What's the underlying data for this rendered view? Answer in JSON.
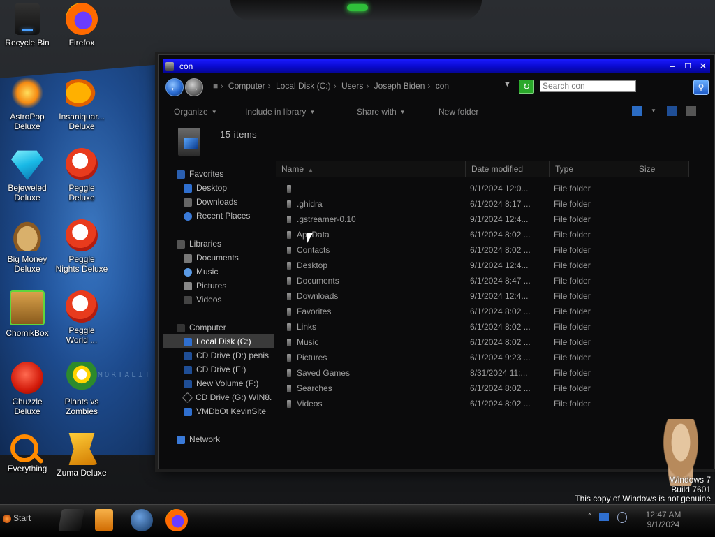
{
  "desktop": {
    "icons": [
      {
        "label": "Recycle Bin",
        "icon": "recycle-bin-icon"
      },
      {
        "label": "Firefox",
        "icon": "firefox-icon"
      },
      {
        "label": "AstroPop\nDeluxe",
        "icon": "astropop-icon"
      },
      {
        "label": "Insaniquar...\nDeluxe",
        "icon": "insaniquarium-icon"
      },
      {
        "label": "Bejeweled\nDeluxe",
        "icon": "bejeweled-icon"
      },
      {
        "label": "Peggle\nDeluxe",
        "icon": "peggle-icon"
      },
      {
        "label": "Big Money\nDeluxe",
        "icon": "big-money-icon"
      },
      {
        "label": "Peggle\nNights Deluxe",
        "icon": "peggle-nights-icon"
      },
      {
        "label": "ChomikBox",
        "icon": "chomikbox-icon"
      },
      {
        "label": "Peggle\nWorld ...",
        "icon": "peggle-world-icon"
      },
      {
        "label": "Chuzzle\nDeluxe",
        "icon": "chuzzle-icon"
      },
      {
        "label": "Plants vs\nZombies",
        "icon": "plants-vs-zombies-icon"
      },
      {
        "label": "Everything",
        "icon": "everything-search-icon"
      },
      {
        "label": "Zuma Deluxe",
        "icon": "zuma-icon"
      }
    ],
    "wallpaper_text": "MORTALIT",
    "watermark": {
      "line1": "Windows 7",
      "line2": "Build 7601",
      "line3": "This copy of Windows is not genuine"
    }
  },
  "window": {
    "title": "con",
    "controls": {
      "minimize": "–",
      "maximize": "☐",
      "close": "✕"
    },
    "breadcrumb": [
      "Computer",
      "Local Disk (C:)",
      "Users",
      "Joseph Biden",
      "con"
    ],
    "search_placeholder": "Search con",
    "commands": {
      "organize": "Organize",
      "include": "Include in library",
      "share": "Share with",
      "new_folder": "New folder"
    },
    "item_count": "15 items",
    "nav": {
      "favorites": "Favorites",
      "fav_items": [
        "Desktop",
        "Downloads",
        "Recent Places"
      ],
      "libraries": "Libraries",
      "lib_items": [
        "Documents",
        "Music",
        "Pictures",
        "Videos"
      ],
      "computer": "Computer",
      "comp_items": [
        "Local Disk (C:)",
        "CD Drive (D:) penis",
        "CD Drive (E:)",
        "New Volume (F:)",
        "CD Drive (G:) WIN8.",
        "VMDbOt KevinSite"
      ],
      "network": "Network"
    },
    "columns": {
      "name": "Name",
      "date": "Date modified",
      "type": "Type",
      "size": "Size"
    },
    "files": [
      {
        "name": "",
        "date": "9/1/2024 12:0...",
        "type": "File folder"
      },
      {
        "name": ".ghidra",
        "date": "6/1/2024 8:17 ...",
        "type": "File folder"
      },
      {
        "name": ".gstreamer-0.10",
        "date": "9/1/2024 12:4...",
        "type": "File folder"
      },
      {
        "name": "AppData",
        "date": "6/1/2024 8:02 ...",
        "type": "File folder"
      },
      {
        "name": "Contacts",
        "date": "6/1/2024 8:02 ...",
        "type": "File folder"
      },
      {
        "name": "Desktop",
        "date": "9/1/2024 12:4...",
        "type": "File folder"
      },
      {
        "name": "Documents",
        "date": "6/1/2024 8:47 ...",
        "type": "File folder"
      },
      {
        "name": "Downloads",
        "date": "9/1/2024 12:4...",
        "type": "File folder"
      },
      {
        "name": "Favorites",
        "date": "6/1/2024 8:02 ...",
        "type": "File folder"
      },
      {
        "name": "Links",
        "date": "6/1/2024 8:02 ...",
        "type": "File folder"
      },
      {
        "name": "Music",
        "date": "6/1/2024 8:02 ...",
        "type": "File folder"
      },
      {
        "name": "Pictures",
        "date": "6/1/2024 9:23 ...",
        "type": "File folder"
      },
      {
        "name": "Saved Games",
        "date": "8/31/2024 11:...",
        "type": "File folder"
      },
      {
        "name": "Searches",
        "date": "6/1/2024 8:02 ...",
        "type": "File folder"
      },
      {
        "name": "Videos",
        "date": "6/1/2024 8:02 ...",
        "type": "File folder"
      }
    ]
  },
  "taskbar": {
    "start_label": "Start",
    "time": "12:47 AM",
    "date": "9/1/2024"
  }
}
